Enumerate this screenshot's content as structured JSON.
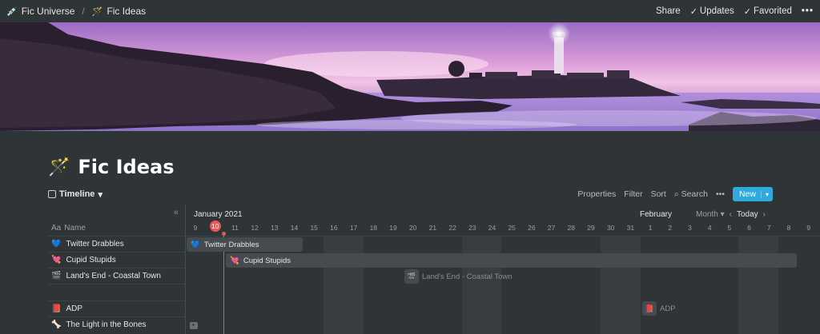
{
  "breadcrumb": [
    {
      "icon": "💉",
      "label": "Fic Universe"
    },
    {
      "icon": "🪄",
      "label": "Fic Ideas"
    }
  ],
  "breadcrumb_sep": "/",
  "top_actions": {
    "share": "Share",
    "updates": "Updates",
    "favorited": "Favorited",
    "more": "•••"
  },
  "page": {
    "icon": "🪄",
    "title": "Fic Ideas"
  },
  "view": {
    "name": "Timeline",
    "caret": "▾"
  },
  "toolbar": {
    "properties": "Properties",
    "filter": "Filter",
    "sort": "Sort",
    "search": "Search",
    "more": "•••",
    "new": "New",
    "new_caret": "▾"
  },
  "timeline": {
    "collapse": "«",
    "name_header": "Name",
    "name_icon": "Aa",
    "months": [
      "January 2021",
      "February"
    ],
    "range": {
      "label": "Month",
      "caret": "▾",
      "prev": "‹",
      "today": "Today",
      "next": "›"
    },
    "days": [
      "9",
      "10",
      "11",
      "12",
      "13",
      "14",
      "15",
      "16",
      "17",
      "18",
      "19",
      "20",
      "21",
      "22",
      "23",
      "24",
      "25",
      "26",
      "27",
      "28",
      "29",
      "30",
      "31",
      "1",
      "2",
      "3",
      "4",
      "5",
      "6",
      "7",
      "8",
      "9"
    ],
    "today_day": "10",
    "rows": [
      {
        "icon": "💙",
        "name": "Twitter Drabbles"
      },
      {
        "icon": "💘",
        "name": "Cupid Stupids"
      },
      {
        "icon": "🎬",
        "name": "Land's End - Coastal Town"
      },
      {
        "icon": "",
        "name": ""
      },
      {
        "icon": "📕",
        "name": "ADP"
      },
      {
        "icon": "🦴",
        "name": "The Light in the Bones"
      }
    ],
    "bars": [
      {
        "icon": "💙",
        "label": "Twitter Drabbles"
      },
      {
        "icon": "💘",
        "label": "Cupid Stupids"
      }
    ],
    "ghosts": [
      {
        "icon": "🎬",
        "label": "Land's End - Coastal Town"
      },
      {
        "icon": "📕",
        "label": "ADP"
      }
    ]
  },
  "colors": {
    "background": "#2f3437",
    "accent": "#2eaadc",
    "today": "#eb5757",
    "bar": "#454b4e"
  }
}
